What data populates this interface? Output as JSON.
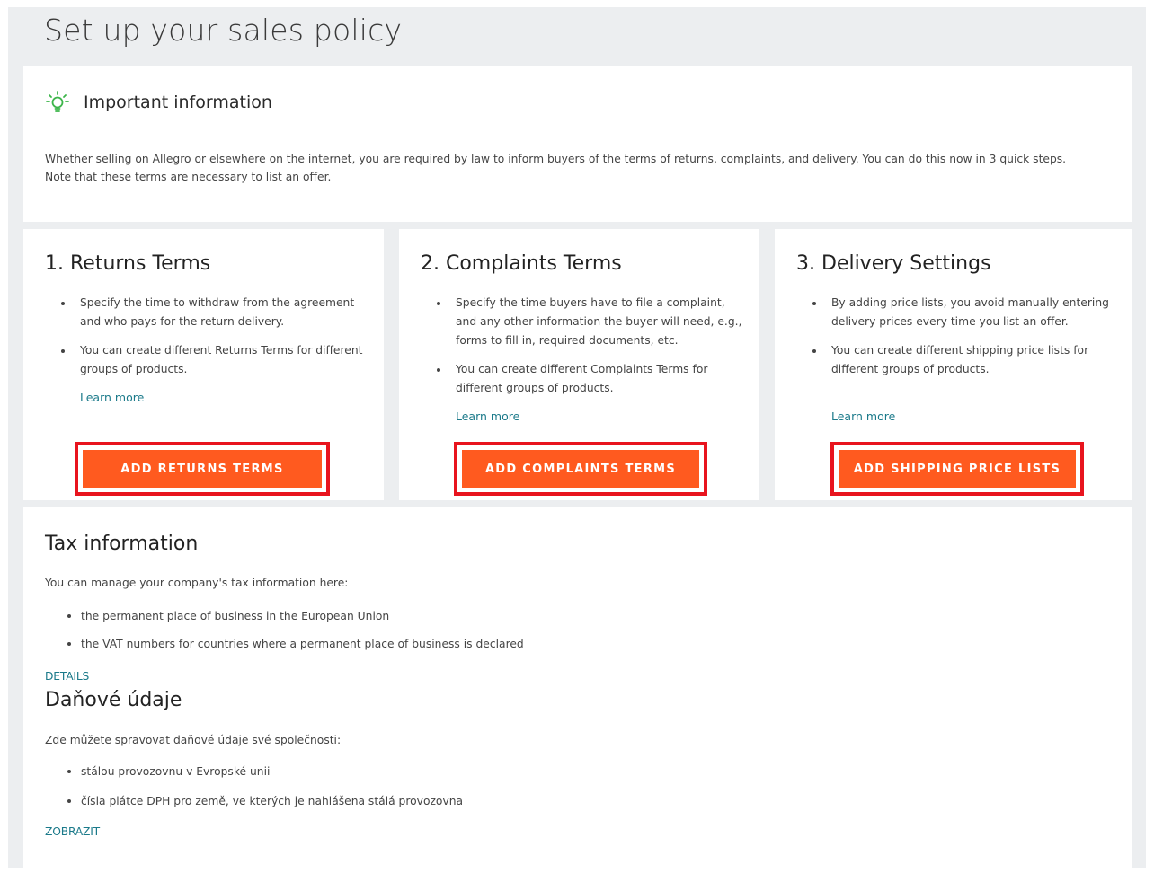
{
  "page": {
    "title": "Set up your sales policy"
  },
  "info": {
    "title": "Important information",
    "text_line1": "Whether selling on Allegro or elsewhere on the internet, you are required by law to inform buyers of the terms of returns, complaints, and delivery. You can do this now in 3 quick steps.",
    "text_line2": "Note that these terms are necessary to list an offer.",
    "icon": "lightbulb-icon",
    "icon_color": "#3cb54a"
  },
  "steps": [
    {
      "title": "1. Returns Terms",
      "bullets": [
        "Specify the time to withdraw from the agreement and who pays for the return delivery.",
        "You can create different Returns Terms for different groups of products."
      ],
      "learn_more": "Learn more",
      "button": "ADD RETURNS TERMS"
    },
    {
      "title": "2. Complaints Terms",
      "bullets": [
        "Specify the time buyers have to file a complaint, and any other information the buyer will need, e.g., forms to fill in, required documents, etc.",
        "You can create different Complaints Terms for different groups of products."
      ],
      "learn_more": "Learn more",
      "button": "ADD COMPLAINTS TERMS"
    },
    {
      "title": "3. Delivery Settings",
      "bullets": [
        "By adding price lists, you avoid manually entering delivery prices every time you list an offer.",
        "You can create different shipping price lists for different groups of products."
      ],
      "learn_more": "Learn more",
      "button": "ADD SHIPPING PRICE LISTS"
    }
  ],
  "tax_en": {
    "title": "Tax information",
    "desc": "You can manage your company's tax information here:",
    "bullets": [
      "the permanent place of business in the European Union",
      "the VAT numbers for countries where a permanent place of business is declared"
    ],
    "link": "DETAILS"
  },
  "tax_cz": {
    "title": "Daňové údaje",
    "desc": "Zde můžete spravovat daňové údaje své společnosti:",
    "bullets": [
      "stálou provozovnu v Evropské unii",
      "čísla plátce DPH pro země, ve kterých je nahlášena stálá provozovna"
    ],
    "link": "ZOBRAZIT"
  },
  "colors": {
    "accent": "#ff5a1f",
    "highlight": "#e8141e",
    "link": "#1b7a8a",
    "background": "#eceef0"
  }
}
